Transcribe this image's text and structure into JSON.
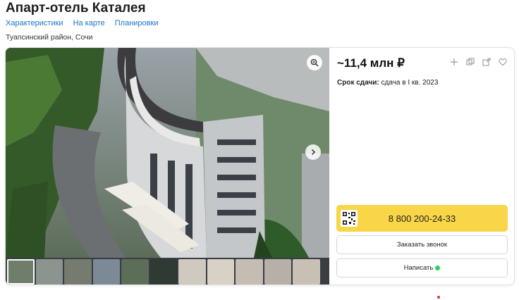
{
  "title": "Апарт-отель Каталея",
  "tabs": [
    "Характеристики",
    "На карте",
    "Планировки"
  ],
  "location": "Туапсинский район, Сочи",
  "price": "~11,4 млн ₽",
  "deadline": {
    "label": "Срок сдачи:",
    "value": "сдача в I кв. 2023"
  },
  "phone": "8 800 200-24-33",
  "buttons": {
    "call": "Заказать звонок",
    "write": "Написать"
  },
  "icons": {
    "zoom": "zoom-in-icon",
    "next": "chevron-right-icon",
    "add": "plus-icon",
    "compare": "compare-icon",
    "share": "share-icon",
    "favorite": "heart-icon",
    "qr": "qr-code-icon",
    "whatsapp": "whatsapp-icon"
  },
  "colors": {
    "link": "#1a73c9",
    "phone_button": "#f9d548",
    "whatsapp": "#25d366"
  },
  "thumbnails": 11
}
